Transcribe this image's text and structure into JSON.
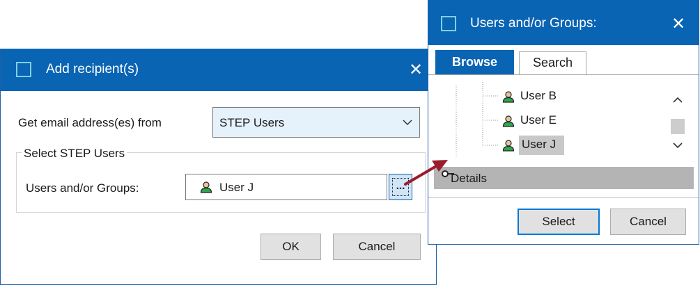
{
  "add_dialog": {
    "title": "Add recipient(s)",
    "get_email_label": "Get email address(es) from",
    "source_select_value": "STEP Users",
    "group_label": "Select STEP Users",
    "users_groups_label": "Users and/or Groups:",
    "selected_user": "User J",
    "browse_button_label": "...",
    "ok_label": "OK",
    "cancel_label": "Cancel"
  },
  "picker_dialog": {
    "title": "Users and/or Groups:",
    "tabs": [
      {
        "label": "Browse",
        "active": true
      },
      {
        "label": "Search",
        "active": false
      }
    ],
    "tree_items": [
      {
        "label": "User B"
      },
      {
        "label": "User E"
      },
      {
        "label": "User J",
        "selected": true
      }
    ],
    "details_label": "Details",
    "select_label": "Select",
    "cancel_label": "Cancel"
  },
  "icons": [
    "window-icon",
    "close-icon",
    "chevron-down-icon",
    "user-icon",
    "scroll-up-icon",
    "scroll-down-icon",
    "collapse-toggle-icon",
    "arrow-annotation"
  ],
  "colors": {
    "titlebar": "#0a64b4",
    "selection": "#c8c8c8",
    "details_bar": "#b4b4b4",
    "arrow": "#9b1c2b",
    "select_button_border": "#0078d7"
  }
}
